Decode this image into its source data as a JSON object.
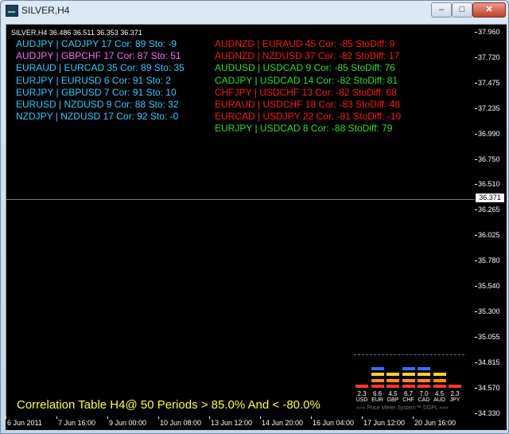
{
  "window": {
    "title": "SILVER,H4",
    "min_glyph": "–",
    "max_glyph": "□",
    "close_glyph": "✕"
  },
  "chart": {
    "symbol_line": "SILVER,H4  36.486 36.511 36.353 36.371",
    "current_price": "36.371",
    "bottom_title": "Correlation Table H4@ 50 Periods > 85.0% And < -80.0%"
  },
  "colors": {
    "cyan": "#33ccff",
    "magenta": "#ff66ff",
    "red": "#ff1a1a",
    "green": "#33dd33",
    "yellow": "#ffff33"
  },
  "left_table": [
    {
      "text": "AUDJPY | CADJPY  17   Cor: 89   Sto:  -9",
      "color": "#33ccff"
    },
    {
      "text": "AUDJPY | GBPCHF  17   Cor: 87   Sto:  51",
      "color": "#ff66ff"
    },
    {
      "text": "EURAUD | EURCAD  35   Cor: 89   Sto:  35",
      "color": "#33ccff"
    },
    {
      "text": "EURJPY | EURUSD  6   Cor: 91   Sto:  2",
      "color": "#33ccff"
    },
    {
      "text": "EURJPY | GBPUSD  7   Cor: 91   Sto:  10",
      "color": "#33ccff"
    },
    {
      "text": "EURUSD | NZDUSD  9   Cor: 88   Sto:  32",
      "color": "#33ccff"
    },
    {
      "text": "NZDJPY | NZDUSD  17   Cor: 92   Sto:  -0",
      "color": "#33ccff"
    }
  ],
  "right_table": [
    {
      "text": "AUDNZD | EURAUD  45   Cor: -85   StoDiff:  9",
      "color": "#ff1a1a"
    },
    {
      "text": "AUDNZD | NZDUSD  37   Cor: -82   StoDiff:  17",
      "color": "#ff1a1a"
    },
    {
      "text": "AUDUSD | USDCAD  9   Cor: -85   StoDiff:  76",
      "color": "#33dd33"
    },
    {
      "text": "CADJPY | USDCAD  14   Cor: -82   StoDiff:  81",
      "color": "#33dd33"
    },
    {
      "text": "CHFJPY | USDCHF  13   Cor: -82   StoDiff:  68",
      "color": "#ff1a1a"
    },
    {
      "text": "EURAUD | USDCHF  18   Cor: -83   StoDiff:  48",
      "color": "#ff1a1a"
    },
    {
      "text": "EURCAD | USDJPY  22   Cor: -81   StoDiff:  -10",
      "color": "#ff1a1a"
    },
    {
      "text": "EURJPY | USDCAD  8   Cor: -88   StoDiff:  79",
      "color": "#33dd33"
    }
  ],
  "price_axis": [
    "37.960",
    "37.720",
    "37.475",
    "37.235",
    "36.990",
    "36.750",
    "36.510",
    "36.265",
    "36.025",
    "35.780",
    "35.540",
    "35.300",
    "35.055",
    "34.815",
    "34.570",
    "34.330"
  ],
  "time_axis": [
    "6 Jun 2011",
    "7 Jun 16:00",
    "9 Jun 00:00",
    "10 Jun 08:00",
    "13 Jun 12:00",
    "14 Jun 20:00",
    "16 Jun 04:00",
    "17 Jun 12:00",
    "20 Jun 16:00"
  ],
  "price_meter": {
    "footer": "»»» Price Meter System™ ©GPL «««",
    "currencies": [
      {
        "code": "USD",
        "value": "2.3",
        "level": 2.3
      },
      {
        "code": "EUR",
        "value": "6.6",
        "level": 6.6
      },
      {
        "code": "GBP",
        "value": "4.5",
        "level": 4.5
      },
      {
        "code": "CHF",
        "value": "6.7",
        "level": 6.7
      },
      {
        "code": "CAD",
        "value": "7.0",
        "level": 7.0
      },
      {
        "code": "AUD",
        "value": "4.5",
        "level": 4.5
      },
      {
        "code": "JPY",
        "value": "2.3",
        "level": 2.3
      }
    ]
  }
}
